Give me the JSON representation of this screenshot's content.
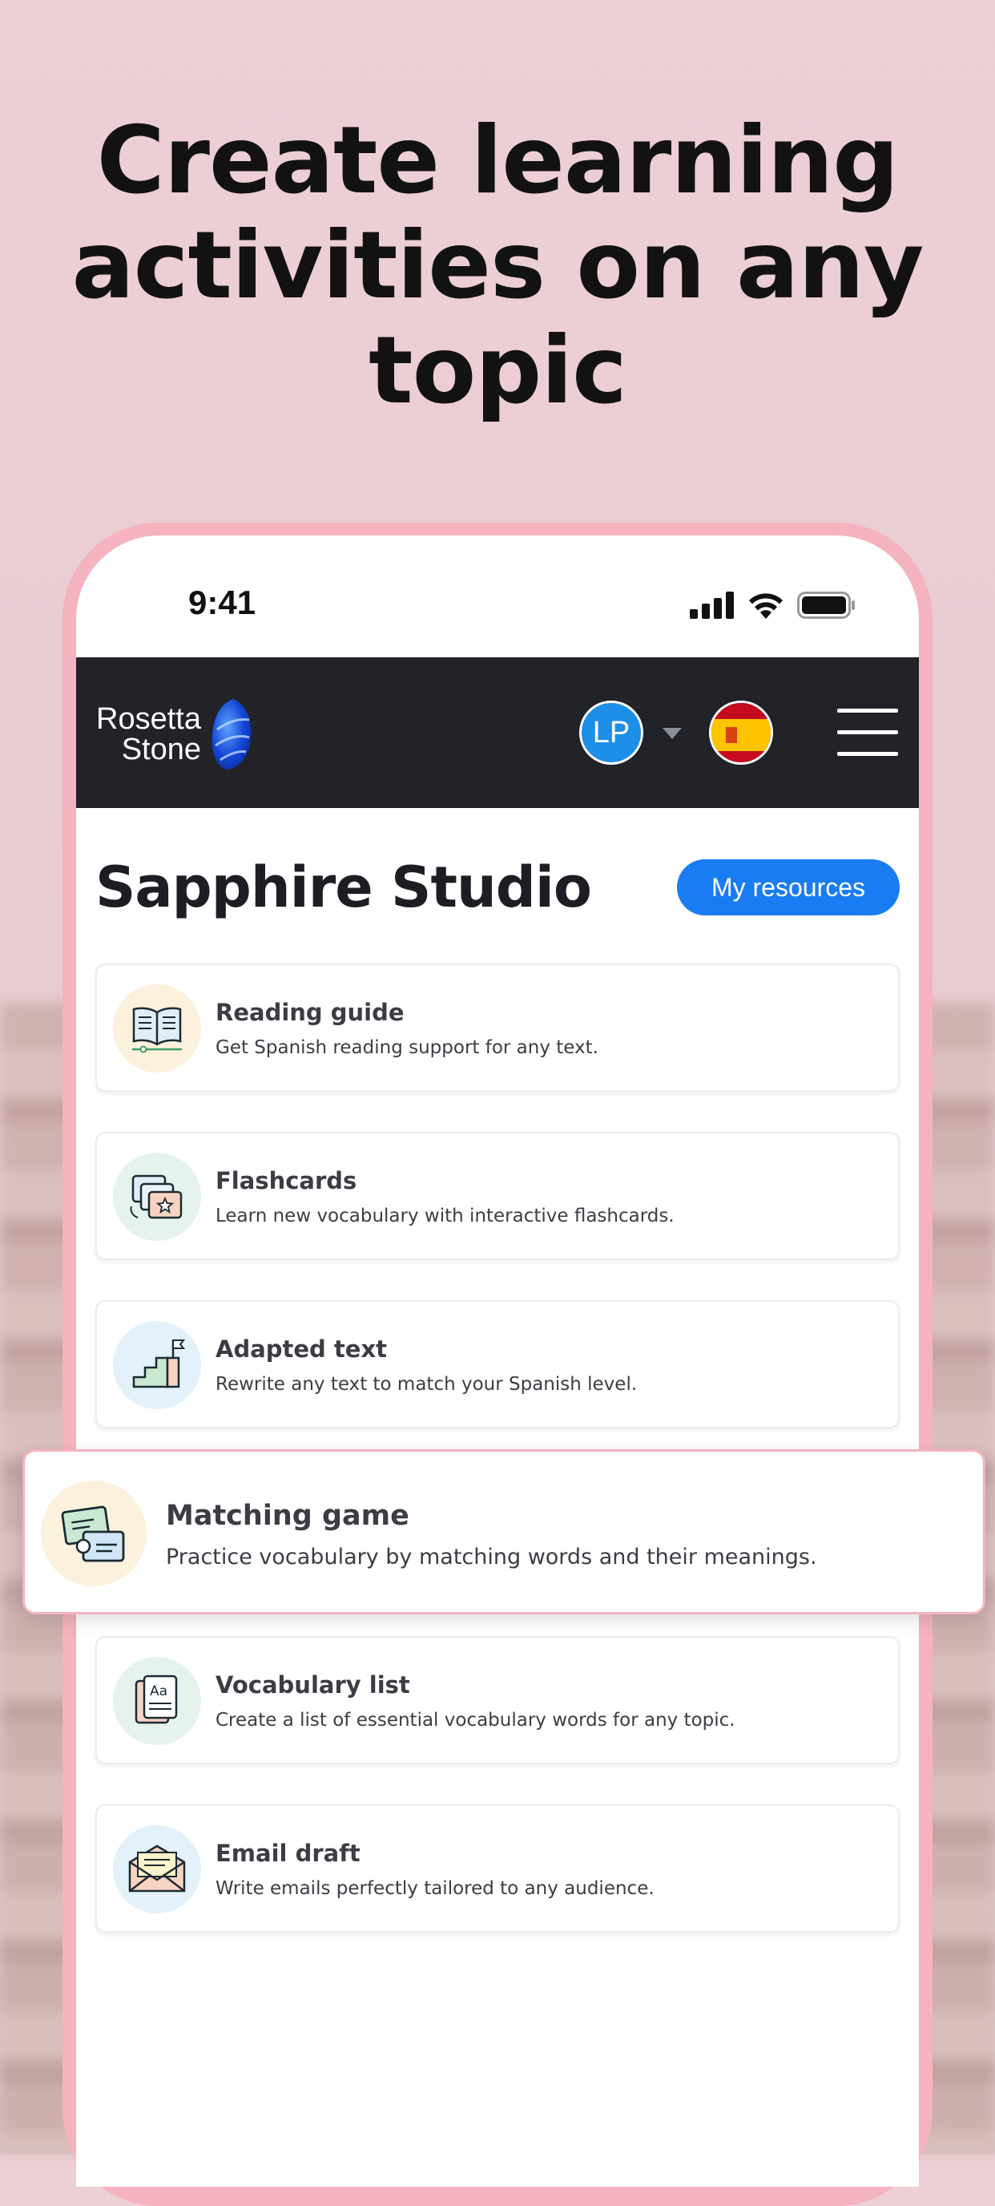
{
  "headline": "Create learning activities on any topic",
  "status_bar": {
    "time": "9:41"
  },
  "navbar": {
    "logo_line1": "Rosetta",
    "logo_line2": "Stone",
    "avatar_initials": "LP",
    "language_flag": "spain-flag-icon"
  },
  "studio": {
    "title": "Sapphire Studio",
    "my_resources_label": "My resources"
  },
  "activities": [
    {
      "title": "Reading guide",
      "description": "Get Spanish reading support for any text.",
      "icon": "open-book-icon",
      "icon_bg": "#fbf1dc"
    },
    {
      "title": "Flashcards",
      "description": "Learn new vocabulary with interactive flashcards.",
      "icon": "flashcards-icon",
      "icon_bg": "#e6f3ec"
    },
    {
      "title": "Adapted text",
      "description": "Rewrite any text to match your Spanish level.",
      "icon": "stairs-flag-icon",
      "icon_bg": "#e3f1fa"
    },
    {
      "title": "Matching game",
      "description": "Practice vocabulary by matching words and their meanings.",
      "icon": "puzzle-cards-icon",
      "icon_bg": "#fbf1dc"
    },
    {
      "title": "Vocabulary list",
      "description": "Create a list of essential vocabulary words for any topic.",
      "icon": "vocabulary-card-icon",
      "icon_bg": "#e6f3ec"
    },
    {
      "title": "Email draft",
      "description": "Write emails perfectly tailored to any audience.",
      "icon": "envelope-icon",
      "icon_bg": "#e3f1fa"
    }
  ],
  "colors": {
    "brand_blue": "#1a7cf3",
    "navbar_bg": "#212329",
    "phone_frame": "#f4b3bf",
    "background": "#edcfd6"
  }
}
